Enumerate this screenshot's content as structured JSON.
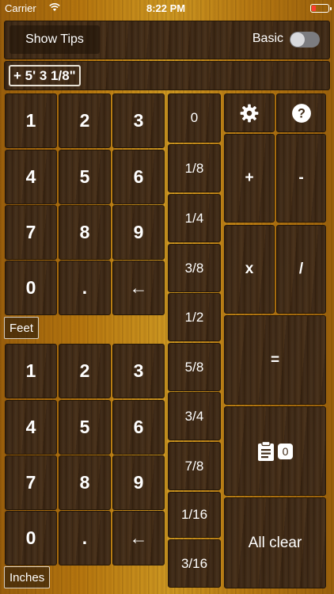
{
  "status_bar": {
    "carrier": "Carrier",
    "time": "8:22 PM"
  },
  "toolbar": {
    "show_tips_label": "Show Tips",
    "mode_label": "Basic",
    "mode_toggle_on": false
  },
  "display": {
    "expression": "+ 5' 3 1/8\""
  },
  "feet_pad": {
    "label": "Feet",
    "keys": [
      "1",
      "2",
      "3",
      "4",
      "5",
      "6",
      "7",
      "8",
      "9",
      "0",
      ".",
      "←"
    ]
  },
  "inches_pad": {
    "label": "Inches",
    "keys": [
      "1",
      "2",
      "3",
      "4",
      "5",
      "6",
      "7",
      "8",
      "9",
      "0",
      ".",
      "←"
    ]
  },
  "fractions": [
    "0",
    "1/8",
    "1/4",
    "3/8",
    "1/2",
    "5/8",
    "3/4",
    "7/8",
    "1/16",
    "3/16"
  ],
  "operators": {
    "add": "+",
    "subtract": "-",
    "multiply": "x",
    "divide": "/",
    "equals": "=",
    "all_clear": "All clear",
    "memory_count": "0"
  },
  "icons": {
    "settings": "gear-icon",
    "help": "question-icon",
    "memory": "clipboard-icon"
  }
}
